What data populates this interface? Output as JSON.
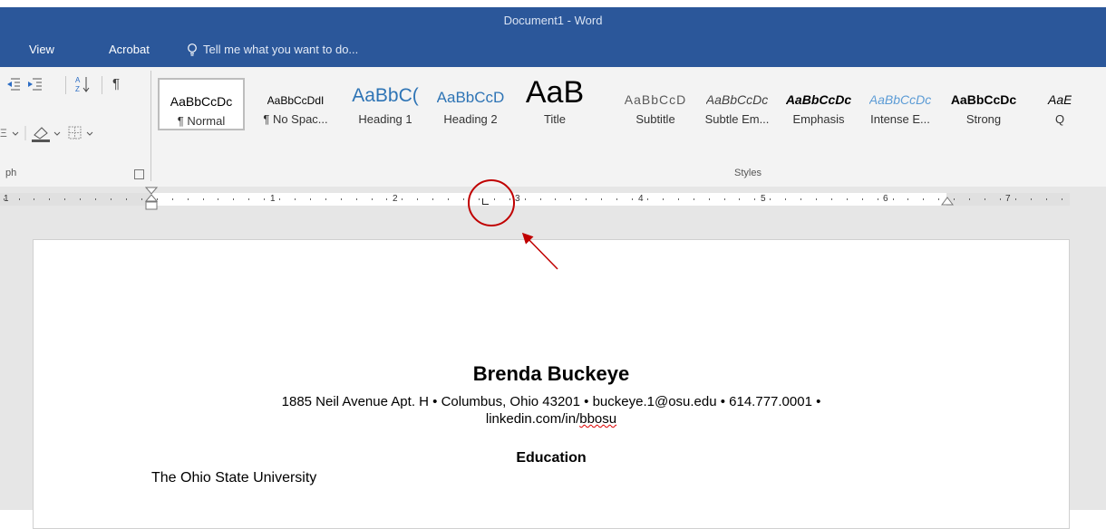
{
  "window": {
    "title": "Document1 - Word"
  },
  "menu": {
    "view": "View",
    "acrobat": "Acrobat",
    "tell_me": "Tell me what you want to do..."
  },
  "ribbon": {
    "paragraph_label": "ph",
    "styles_label": "Styles",
    "styles": [
      {
        "preview": "AaBbCcDc",
        "name": "¶ Normal",
        "color": "#000000"
      },
      {
        "preview": "AaBbCcDdI",
        "name": "¶ No Spac...",
        "color": "#000000"
      },
      {
        "preview": "AaBbC(",
        "name": "Heading 1",
        "color": "#2e74b5"
      },
      {
        "preview": "AaBbCcD",
        "name": "Heading 2",
        "color": "#2e74b5"
      },
      {
        "preview": "AaB",
        "name": "Title",
        "color": "#000000"
      },
      {
        "preview": "AaBbCcD",
        "name": "Subtitle",
        "color": "#595959"
      },
      {
        "preview": "AaBbCcDc",
        "name": "Subtle Em...",
        "color": "#404040"
      },
      {
        "preview": "AaBbCcDc",
        "name": "Emphasis",
        "color": "#000000"
      },
      {
        "preview": "AaBbCcDc",
        "name": "Intense E...",
        "color": "#5b9bd5"
      },
      {
        "preview": "AaBbCcDc",
        "name": "Strong",
        "color": "#000000"
      },
      {
        "preview": "AaE",
        "name": "Q",
        "color": "#000000"
      }
    ]
  },
  "ruler": {
    "numbers": [
      "1",
      "1",
      "2",
      "3",
      "4",
      "5",
      "6",
      "7"
    ]
  },
  "document": {
    "name": "Brenda Buckeye",
    "address_line": "1885 Neil Avenue Apt. H • Columbus, Ohio 43201 • buckeye.1@osu.edu • 614.777.0001 •",
    "linkedin_prefix": "linkedin.com/in/",
    "linkedin_handle": "bbosu",
    "section_heading": "Education",
    "school": "The Ohio State University"
  },
  "colors": {
    "accent": "#2b579a",
    "annotation": "#c00000"
  }
}
